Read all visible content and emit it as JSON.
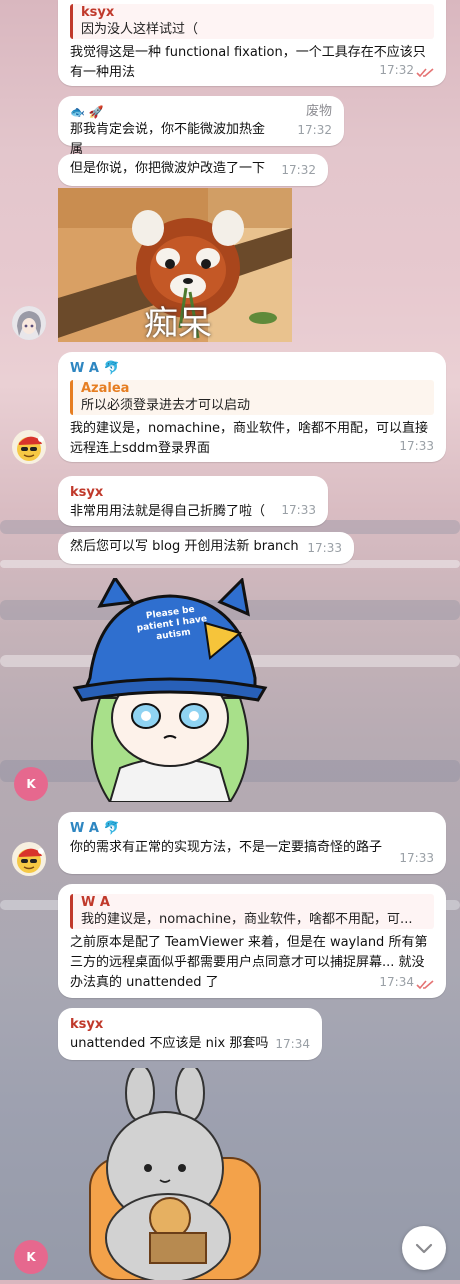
{
  "messages": {
    "m1": {
      "quote_name": "ksyx",
      "quote_text": "因为没人这样试过（",
      "text": "我觉得这是一种 functional fixation，一个工具存在不应该只有一种用法",
      "time": "17:32"
    },
    "m2": {
      "sender_emoji": "🐟 🚀",
      "tag": "废物",
      "text": "那我肯定会说，你不能微波加热金属",
      "time": "17:32"
    },
    "m3": {
      "text": "但是你说，你把微波炉改造了一下",
      "time": "17:32"
    },
    "sticker1": {
      "caption": "痴呆"
    },
    "m4": {
      "sender": "W A 🐬",
      "quote_name": "Azalea",
      "quote_text": "所以必须登录进去才可以启动",
      "text": "我的建议是，nomachine，商业软件，啥都不用配，可以直接远程连上sddm登录界面",
      "time": "17:33"
    },
    "m5": {
      "sender": "ksyx",
      "text": "非常用用法就是得自己折腾了啦（",
      "time": "17:33"
    },
    "m6": {
      "text": "然后您可以写 blog 开创用法新 branch",
      "time": "17:33"
    },
    "sticker2": {
      "hat_text": "Please be patient I have autism"
    },
    "m7": {
      "sender": "W A 🐬",
      "text": "你的需求有正常的实现方法，不是一定要搞奇怪的路子",
      "time": "17:33"
    },
    "m8": {
      "quote_name": "W A",
      "quote_text": "我的建议是，nomachine，商业软件，啥都不用配，可...",
      "text": "之前原本是配了 TeamViewer 来着，但是在 wayland 所有第三方的远程桌面似乎都需要用户点同意才可以捕捉屏幕... 就没办法真的 unattended 了",
      "time": "17:34"
    },
    "m9": {
      "sender": "ksyx",
      "text": "unattended 不应该是 nix 那套吗",
      "time": "17:34"
    },
    "avatars": {
      "k_letter": "K"
    }
  },
  "colors": {
    "ksyx": "#c0392b",
    "wa": "#2e86c1",
    "azalea": "#e67e22",
    "tag": "#8e8e93",
    "read_checks": "#e57373"
  },
  "icons": {
    "scroll_down": "chevron-down-icon",
    "read_status": "double-check-icon"
  }
}
